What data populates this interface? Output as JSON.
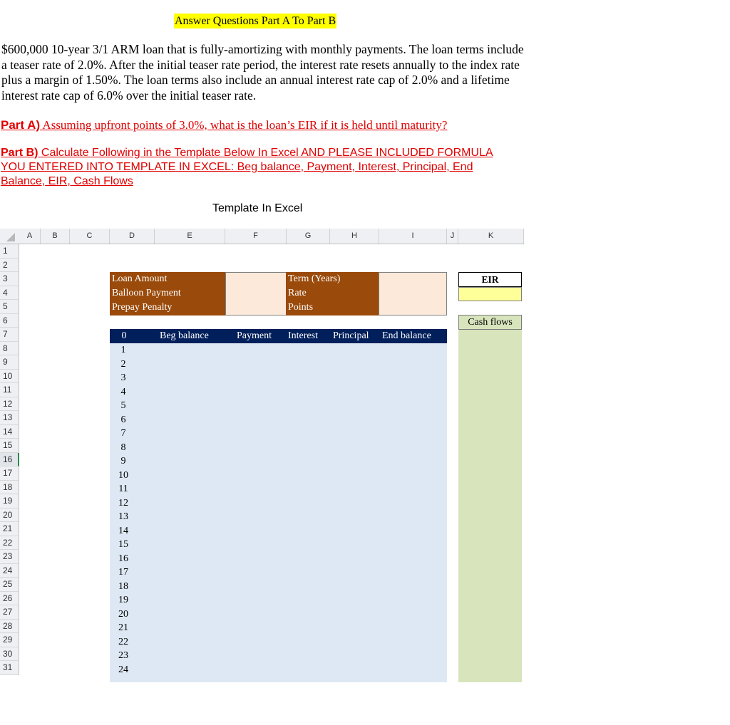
{
  "title": "Answer Questions Part A To Part B",
  "problem": "$600,000 10-year 3/1 ARM loan that is fully-amortizing with monthly payments. The loan terms include a teaser rate of 2.0%. After the initial teaser rate period, the interest rate resets annually to the index rate plus a margin of 1.50%. The loan terms also include an annual interest rate cap of 2.0% and a lifetime interest rate cap of 6.0% over the initial teaser rate.",
  "part_a": {
    "label": "Part A)",
    "text": " Assuming upfront points of 3.0%, what is the loan’s EIR if it is held until maturity?"
  },
  "part_b": {
    "label": "Part B)",
    "text": " Calculate Following in the Template Below In Excel AND PLEASE INCLUDED FORMULA YOU ENTERED INTO TEMPLATE IN EXCEL: Beg balance, Payment, Interest, Principal, End Balance, EIR, Cash Flows"
  },
  "template_label": "Template In Excel",
  "sheet": {
    "columns": [
      "A",
      "B",
      "C",
      "D",
      "E",
      "F",
      "G",
      "H",
      "I",
      "J",
      "K"
    ],
    "rows": [
      "1",
      "2",
      "3",
      "4",
      "5",
      "6",
      "7",
      "8",
      "9",
      "10",
      "11",
      "12",
      "13",
      "14",
      "15",
      "16",
      "17",
      "18",
      "19",
      "20",
      "21",
      "22",
      "23",
      "24",
      "25",
      "26",
      "27",
      "28",
      "29",
      "30",
      "31"
    ],
    "inputs_left": [
      "Loan Amount",
      "Balloon Payment",
      "Prepay Penalty"
    ],
    "inputs_right": [
      "Term (Years)",
      "Rate",
      "Points"
    ],
    "eir_label": "EIR",
    "cash_flows_label": "Cash flows",
    "table_headers": {
      "period": "0",
      "beg": "Beg balance",
      "payment": "Payment",
      "interest": "Interest",
      "principal": "Principal",
      "end": "End balance"
    },
    "periods": [
      "1",
      "2",
      "3",
      "4",
      "5",
      "6",
      "7",
      "8",
      "9",
      "10",
      "11",
      "12",
      "13",
      "14",
      "15",
      "16",
      "17",
      "18",
      "19",
      "20",
      "21",
      "22",
      "23",
      "24"
    ]
  }
}
